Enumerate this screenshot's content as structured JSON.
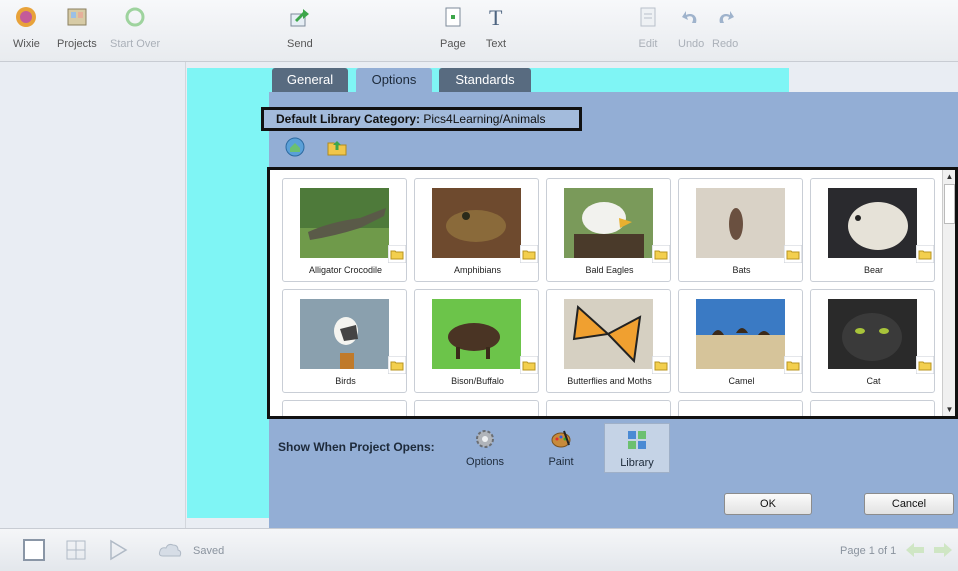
{
  "toolbar": {
    "wixie": "Wixie",
    "projects": "Projects",
    "start_over": "Start Over",
    "send": "Send",
    "page": "Page",
    "text": "Text",
    "edit": "Edit",
    "undo": "Undo",
    "redo": "Redo"
  },
  "dialog": {
    "tabs": [
      "General",
      "Options",
      "Standards"
    ],
    "active_tab": "Options",
    "default_library_label": "Default Library Category:",
    "default_library_value": "Pics4Learning/Animals",
    "library_items": [
      {
        "label": "Alligator Crocodile"
      },
      {
        "label": "Amphibians"
      },
      {
        "label": "Bald Eagles"
      },
      {
        "label": "Bats"
      },
      {
        "label": "Bear"
      },
      {
        "label": "Birds"
      },
      {
        "label": "Bison/Buffalo"
      },
      {
        "label": "Butterflies and Moths"
      },
      {
        "label": "Camel"
      },
      {
        "label": "Cat"
      }
    ],
    "show_when_label": "Show When Project Opens:",
    "open_options": [
      {
        "label": "Options",
        "selected": false
      },
      {
        "label": "Paint",
        "selected": false
      },
      {
        "label": "Library",
        "selected": true
      }
    ],
    "ok": "OK",
    "cancel": "Cancel"
  },
  "status": {
    "saved": "Saved",
    "page_of": "Page 1 of 1"
  },
  "colors": {
    "dialog_bg": "#93aed5",
    "tab_dark": "#586b80",
    "canvas_cyan": "#7ff5f5"
  }
}
